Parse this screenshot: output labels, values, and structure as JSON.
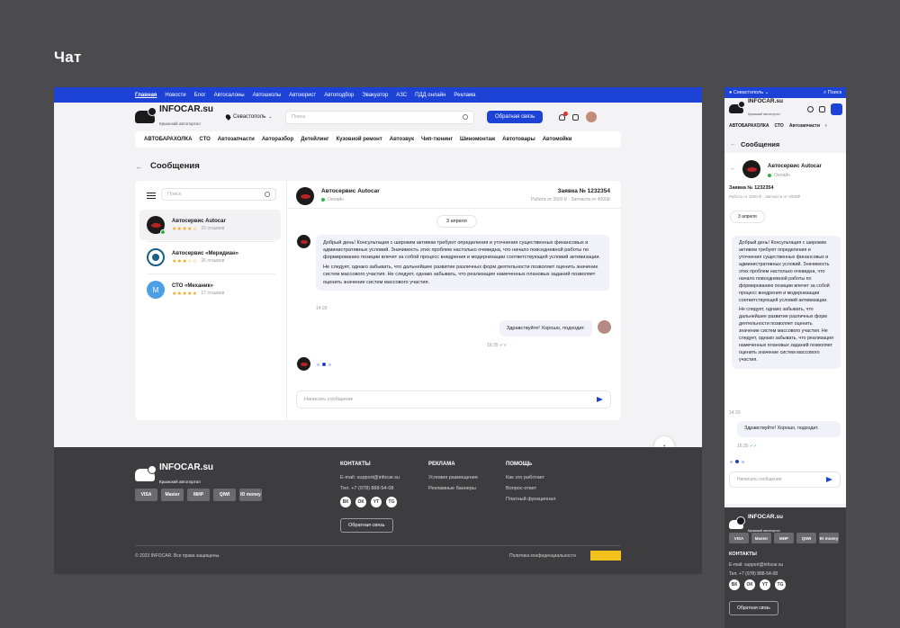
{
  "page_heading": "Чат",
  "desktop": {
    "topnav": [
      "Главная",
      "Новости",
      "Блог",
      "Автосалоны",
      "Автошколы",
      "Автоюрист",
      "Автоподбор",
      "Эвакуатор",
      "АЗС",
      "ПДД онлайн",
      "Реклама"
    ],
    "logo": {
      "name": "INFOCAR.su",
      "tagline": "Крымский автопортал"
    },
    "city": "Севастополь",
    "search_placeholder": "Поиск",
    "feedback_button": "Обратная связь",
    "categories": [
      "АВТОБАРАХОЛКА",
      "СТО",
      "Автозапчасти",
      "Авторазбор",
      "Детейлинг",
      "Кузовной ремонт",
      "Автозвук",
      "Чип-тюнинг",
      "Шиномонтаж",
      "Автотовары",
      "Автомойки"
    ],
    "page_title": "Сообщения",
    "sidebar_search_placeholder": "Поиск",
    "contacts": [
      {
        "name": "Автосервис Autocar",
        "stars": "★★★★☆",
        "reviews": "15 отзывов"
      },
      {
        "name": "Автосервис «Меридиан»",
        "stars": "★★★☆☆",
        "reviews": "26 отзывов"
      },
      {
        "name": "СТО «Механик»",
        "stars": "★★★★★",
        "reviews": "17 отзывов",
        "initial": "M"
      }
    ],
    "chat": {
      "name": "Автосервис Autocar",
      "status": "Онлайн",
      "order": "Заявка № 1232354",
      "order_details": "Работа от 3500 ₽ · Запчасти от 4000₽",
      "date": "3 апреля",
      "msg1_p1": "Добрый день! Консультация с широким активом требуют определения и уточнения существенных финансовых и административных условий. Значимость этих проблем настолько очевидна, что начало повседневной работы по формированию позиции влечет за собой процесс внедрения и модернизации соответствующей условий активизации.",
      "msg1_p2": "Не следует, однако забывать, что дальнейшее развитие различных форм деятельности позволяет оценить значение систем массового участия. Не следует, однако забывать, что реализация намеченных плановых заданий позволяет оценить значение систем массового участия.",
      "msg1_time": "14:20",
      "msg2": "Здравствуйте! Хорошо, подходит.",
      "msg2_time": "16:35",
      "compose_placeholder": "Написать сообщение"
    },
    "footer": {
      "logo": {
        "name": "INFOCAR.su",
        "tagline": "Крымский автопортал"
      },
      "payments": [
        "VISA",
        "Master",
        "МИР",
        "QIWI",
        "Ю money"
      ],
      "contacts_title": "КОНТАКТЫ",
      "email": "E-mail: support@infocar.su",
      "phone": "Тел. +7 (978) 888-54-08",
      "socials": [
        "ВК",
        "ОК",
        "YT",
        "TG"
      ],
      "feedback_button": "Обратная связь",
      "ads_title": "РЕКЛАМА",
      "ads_links": [
        "Условия размещения",
        "Рекламные баннеры"
      ],
      "help_title": "ПОМОЩЬ",
      "help_links": [
        "Как это работает",
        "Вопрос-ответ",
        "Платный функционал"
      ],
      "copyright": "© 2023 INFOCAR. Все права защищены.",
      "policy": "Политика конфиденциальности"
    }
  },
  "mobile": {
    "city": "Севастополь",
    "search": "Поиск",
    "logo": {
      "name": "INFOCAR.su",
      "tagline": "Крымский автопортал"
    },
    "categories": [
      "АВТОБАРАХОЛКА",
      "СТО",
      "Автозапчасти"
    ],
    "page_title": "Сообщения",
    "chat": {
      "name": "Автосервис Autocar",
      "status": "Онлайн",
      "order": "Заявка № 1232354",
      "order_details": "Работа от 3500 ₽ · Запчасти от 4000₽",
      "date": "3 апреля",
      "msg1_p1": "Добрый день! Консультация с широким активом требуют определения и уточнения существенных финансовых и административных условий. Значимость этих проблем настолько очевидна, что начало повседневной работы по формированию позиции влечет за собой процесс внедрения и модернизации соответствующей условий активизации.",
      "msg1_p2": "Не следует, однако забывать, что дальнейшее развитие различных форм деятельности позволяет оценить значение систем массового участия. Не следует, однако забывать, что реализация намеченных плановых заданий позволяет оценить значение систем массового участия.",
      "msg1_time": "14:20",
      "msg2": "Здравствуйте! Хорошо, подходит.",
      "msg2_time": "16:35",
      "compose_placeholder": "Написать сообщение"
    },
    "footer": {
      "logo": {
        "name": "INFOCAR.su",
        "tagline": "Крымский автопортал"
      },
      "payments": [
        "VISA",
        "Master",
        "МИР",
        "QIWI",
        "Ю money"
      ],
      "contacts_title": "КОНТАКТЫ",
      "email": "E-mail: support@infocar.su",
      "phone": "Тел. +7 (978) 888-54-08",
      "socials": [
        "ВК",
        "ОК",
        "YT",
        "TG"
      ],
      "feedback_button": "Обратная связь"
    }
  }
}
